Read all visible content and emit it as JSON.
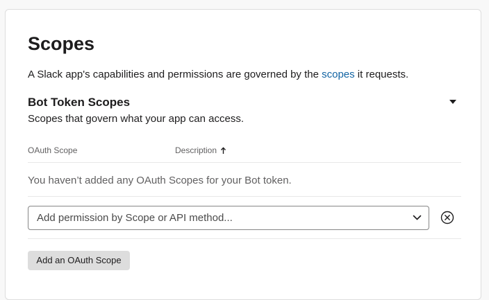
{
  "scopes": {
    "title": "Scopes",
    "description_before": "A Slack app's capabilities and permissions are governed by the ",
    "description_link": "scopes",
    "description_after": " it requests."
  },
  "bot_token": {
    "title": "Bot Token Scopes",
    "subtitle": "Scopes that govern what your app can access.",
    "columns": {
      "oauth_scope": "OAuth Scope",
      "description": "Description"
    },
    "empty_message": "You haven’t added any OAuth Scopes for your Bot token.",
    "select_placeholder": "Add permission by Scope or API method...",
    "add_button": "Add an OAuth Scope",
    "icons": {
      "collapse": "caret-down-icon",
      "sort": "arrow-up-icon",
      "dropdown": "chevron-down-icon",
      "clear": "close-circle-icon"
    }
  },
  "colors": {
    "link": "#1264a3",
    "text": "#1d1c1d",
    "muted": "#616061",
    "button_bg": "#dddddd"
  }
}
